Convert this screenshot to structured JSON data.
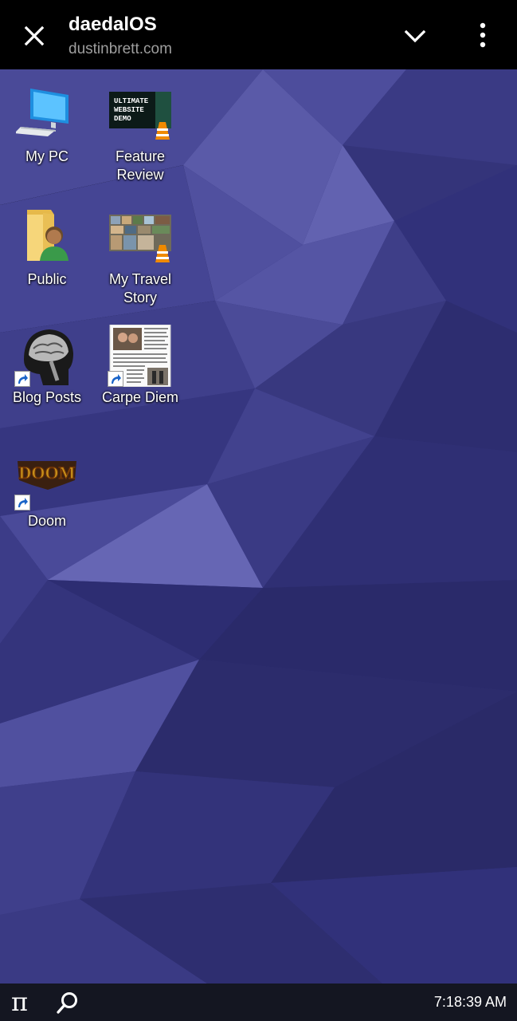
{
  "browser": {
    "title": "daedalOS",
    "url": "dustinbrett.com",
    "close_icon": "close-icon",
    "collapse_icon": "chevron-down-icon",
    "menu_icon": "more-vert-icon"
  },
  "desktop": {
    "background_colors": [
      "#3b3b86",
      "#2c2c6a",
      "#52519c",
      "#6464b4"
    ],
    "icons": [
      {
        "label": "My PC",
        "icon": "computer-icon",
        "shortcut": false
      },
      {
        "label": "Feature Review",
        "icon": "video-thumbnail-icon",
        "thumb_text": "ULTIMATE WEBSITE DEMO",
        "shortcut": false
      },
      {
        "label": "Public",
        "icon": "user-folder-icon",
        "shortcut": false
      },
      {
        "label": "My Travel Story",
        "icon": "video-thumbnail-icon",
        "shortcut": false
      },
      {
        "label": "Blog Posts",
        "icon": "brain-scan-icon",
        "shortcut": true
      },
      {
        "label": "Carpe Diem",
        "icon": "document-thumbnail-icon",
        "shortcut": true
      },
      {
        "label": "Doom",
        "icon": "doom-logo-icon",
        "thumb_text": "DOOM",
        "shortcut": true
      }
    ]
  },
  "taskbar": {
    "start_glyph": "π",
    "search_icon": "search-icon",
    "clock": "7:18:39 AM"
  }
}
